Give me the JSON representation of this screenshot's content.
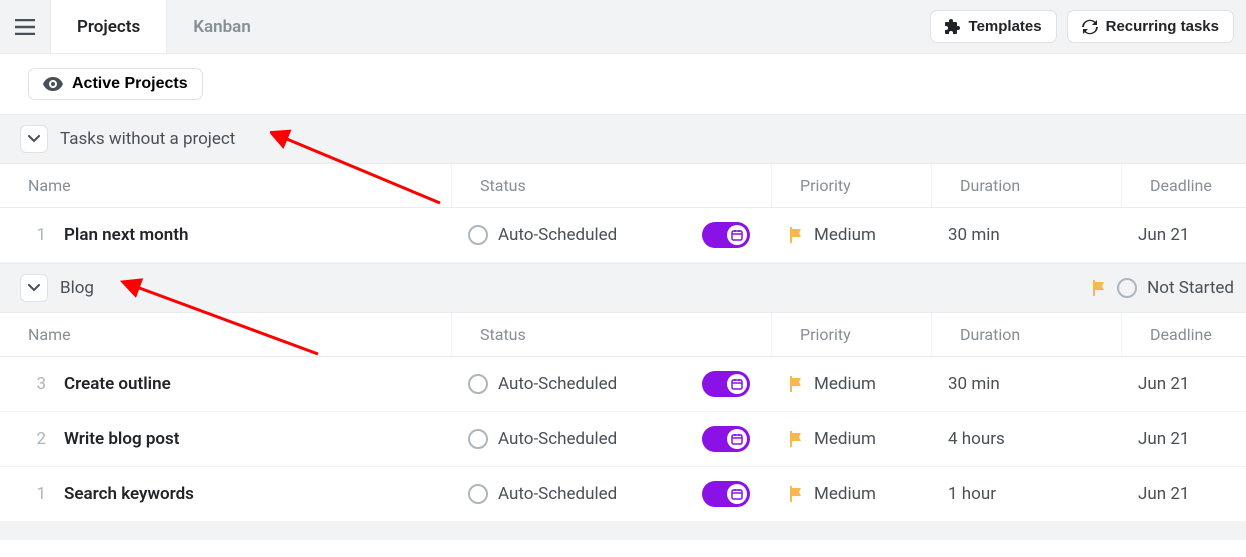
{
  "tabs": {
    "projects": "Projects",
    "kanban": "Kanban"
  },
  "buttons": {
    "templates": "Templates",
    "recurring": "Recurring tasks"
  },
  "filter": {
    "active": "Active Projects"
  },
  "columns": {
    "name": "Name",
    "status": "Status",
    "priority": "Priority",
    "duration": "Duration",
    "deadline": "Deadline"
  },
  "sections": [
    {
      "title": "Tasks without a project",
      "status_label": null,
      "tasks": [
        {
          "num": "1",
          "name": "Plan next month",
          "status": "Auto-Scheduled",
          "priority": "Medium",
          "duration": "30 min",
          "deadline": "Jun 21"
        }
      ]
    },
    {
      "title": "Blog",
      "status_label": "Not Started",
      "tasks": [
        {
          "num": "3",
          "name": "Create outline",
          "status": "Auto-Scheduled",
          "priority": "Medium",
          "duration": "30 min",
          "deadline": "Jun 21"
        },
        {
          "num": "2",
          "name": "Write blog post",
          "status": "Auto-Scheduled",
          "priority": "Medium",
          "duration": "4 hours",
          "deadline": "Jun 21"
        },
        {
          "num": "1",
          "name": "Search keywords",
          "status": "Auto-Scheduled",
          "priority": "Medium",
          "duration": "1 hour",
          "deadline": "Jun 21"
        }
      ]
    }
  ]
}
